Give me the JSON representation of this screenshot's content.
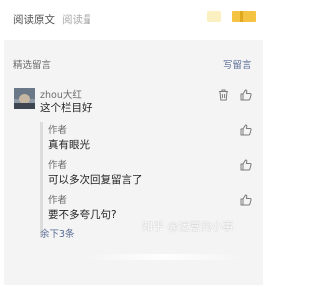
{
  "topbar": {
    "tab_read_original": "阅读原文",
    "tab_read_partial": "阅读量",
    "swatch_colors": [
      "#fbf0c2",
      "#f5c343"
    ]
  },
  "comments": {
    "header": "精选留言",
    "write_link": "写留言",
    "items": [
      {
        "author": "zhou大红",
        "text": "这个栏目好",
        "icons": [
          "trash-icon",
          "like-icon"
        ],
        "replies": [
          {
            "author": "作者",
            "text": "真有眼光",
            "icon": "like-icon"
          },
          {
            "author": "作者",
            "text": "可以多次回复留言了",
            "icon": "like-icon"
          },
          {
            "author": "作者",
            "text": "要不多夸几句?",
            "icon": "like-icon"
          }
        ],
        "more_replies": "余下3条"
      }
    ]
  },
  "watermark": "知乎 @运营的小事",
  "colors": {
    "link": "#576b95",
    "panel_bg": "#f4f4f4",
    "text_primary": "#222222",
    "text_secondary": "#6b6b6b"
  }
}
